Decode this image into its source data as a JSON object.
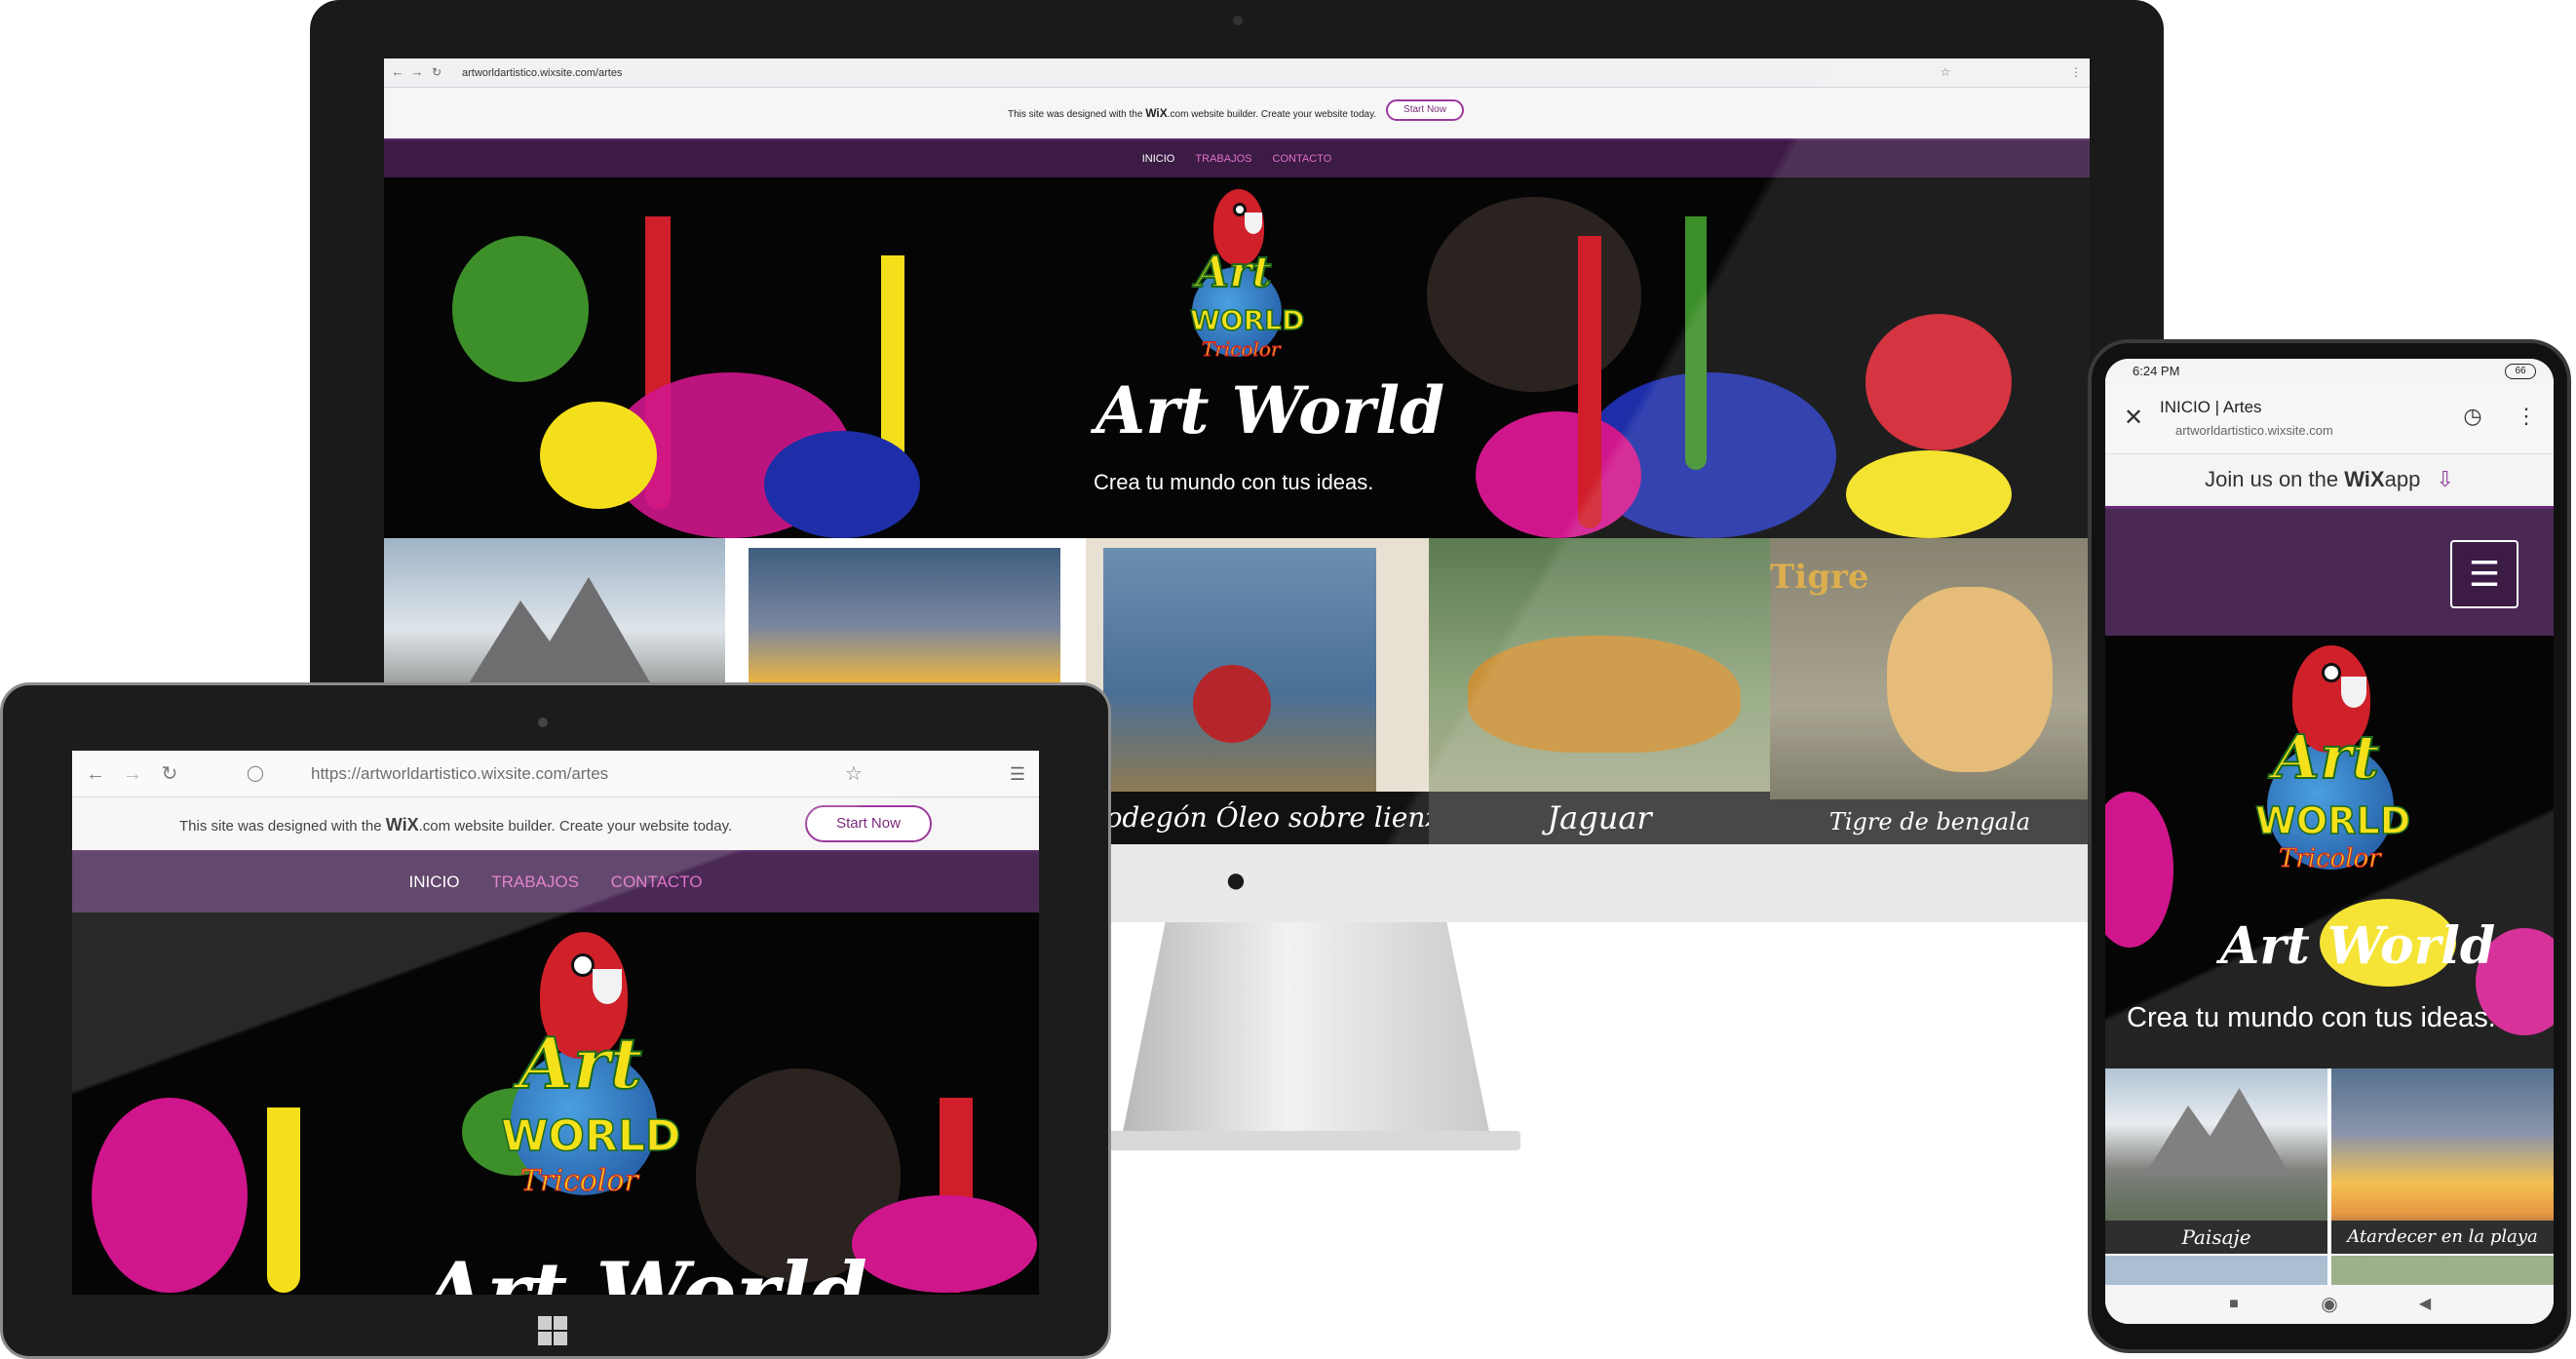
{
  "site": {
    "url_path": "artworldartistico.wixsite.com/artes",
    "url_full": "https://artworldartistico.wixsite.com/artes",
    "url_domain": "artworldartistico.wixsite.com",
    "tab_title": "INICIO | Artes"
  },
  "wix_banner": {
    "text_before": "This site was designed with the",
    "wix_logo": "WiX",
    "text_after": ".com website builder. Create your website today.",
    "button": "Start Now"
  },
  "app_banner": {
    "text": "Join us on the",
    "wix": "WiX",
    "app": "app"
  },
  "nav": {
    "inicio": "INICIO",
    "trabajos": "TRABAJOS",
    "contacto": "CONTACTO"
  },
  "hero": {
    "logo_art": "Art",
    "logo_world": "WORLD",
    "logo_tricolor": "Tricolor",
    "title": "Art World",
    "subtitle": "Crea tu mundo con tus ideas."
  },
  "gallery": [
    {
      "caption": "Paisaje"
    },
    {
      "caption": "Atardecer en la playa"
    },
    {
      "caption": "Bodegón Óleo sobre lienzo"
    },
    {
      "caption": "Jaguar"
    },
    {
      "caption": "Tigre de bengala",
      "sign": "Tigre"
    }
  ],
  "phone_status": {
    "time": "6:24 PM",
    "battery": "66"
  },
  "colors": {
    "nav_purple": "#3c1b45",
    "link_pink": "#e070c8",
    "splat_red": "#d01e2a",
    "splat_magenta": "#d0168c",
    "splat_yellow": "#f4e01a",
    "splat_green": "#3d8f2a",
    "splat_blue": "#1e2ea8"
  },
  "icons": [
    "back-icon",
    "forward-icon",
    "reload-icon",
    "star-icon",
    "menu-icon",
    "hamburger-icon",
    "close-icon",
    "download-icon",
    "apple-logo-icon",
    "windows-logo-icon"
  ]
}
